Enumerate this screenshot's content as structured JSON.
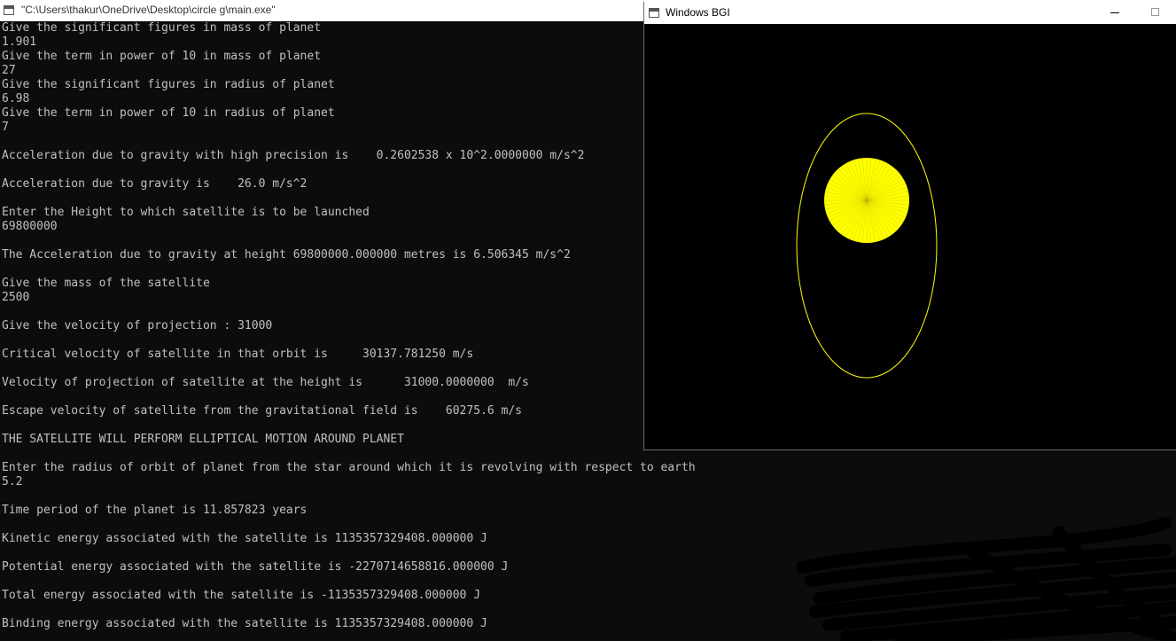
{
  "console": {
    "title": "\"C:\\Users\\thakur\\OneDrive\\Desktop\\circle g\\main.exe\"",
    "lines": [
      "Give the significant figures in mass of planet",
      "1.901",
      "Give the term in power of 10 in mass of planet",
      "27",
      "Give the significant figures in radius of planet",
      "6.98",
      "Give the term in power of 10 in radius of planet",
      "7",
      "",
      "Acceleration due to gravity with high precision is    0.2602538 x 10^2.0000000 m/s^2",
      "",
      "Acceleration due to gravity is    26.0 m/s^2",
      "",
      "Enter the Height to which satellite is to be launched",
      "69800000",
      "",
      "The Acceleration due to gravity at height 69800000.000000 metres is 6.506345 m/s^2",
      "",
      "Give the mass of the satellite",
      "2500",
      "",
      "Give the velocity of projection : 31000",
      "",
      "Critical velocity of satellite in that orbit is     30137.781250 m/s",
      "",
      "Velocity of projection of satellite at the height is      31000.0000000  m/s",
      "",
      "Escape velocity of satellite from the gravitational field is    60275.6 m/s",
      "",
      "THE SATELLITE WILL PERFORM ELLIPTICAL MOTION AROUND PLANET",
      "",
      "Enter the radius of orbit of planet from the star around which it is revolving with respect to earth",
      "5.2",
      "",
      "Time period of the planet is 11.857823 years",
      "",
      "Kinetic energy associated with the satellite is 1135357329408.000000 J",
      "",
      "Potential energy associated with the satellite is -2270714658816.000000 J",
      "",
      "Total energy associated with the satellite is -1135357329408.000000 J",
      "",
      "Binding energy associated with the satellite is 1135357329408.000000 J"
    ]
  },
  "bgi": {
    "title": "Windows BGI",
    "orbit_color": "#ffff00",
    "planet_color": "#ffff00",
    "background": "#000000"
  },
  "icons": {
    "console_icon": "console-window-icon",
    "bgi_icon": "window-icon",
    "minimize": "minimize-icon",
    "maximize": "maximize-icon"
  }
}
